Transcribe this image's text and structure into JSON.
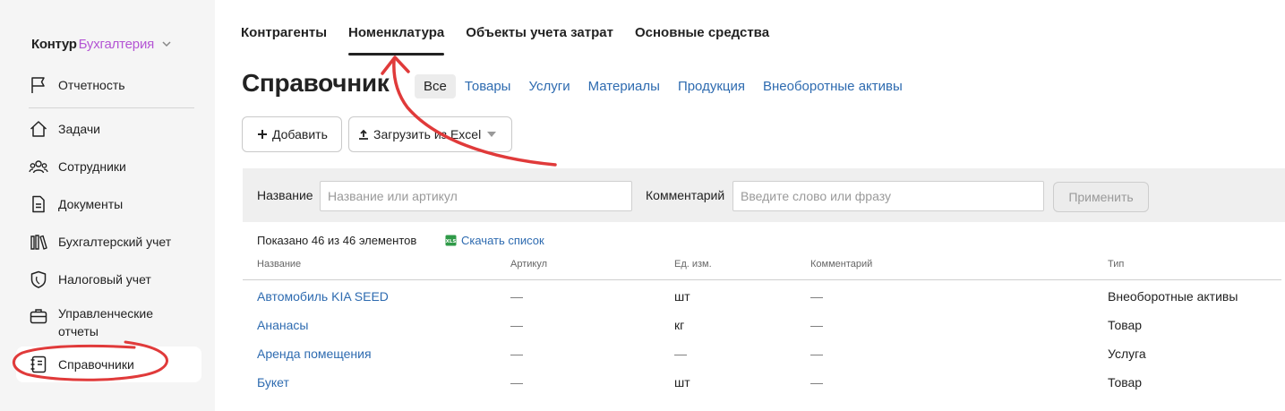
{
  "sidebar": {
    "brand": {
      "name": "Контур",
      "product": "Бухгалтерия"
    },
    "items": [
      {
        "id": "reporting",
        "label": "Отчетность",
        "icon": "flag-icon"
      },
      {
        "id": "tasks",
        "label": "Задачи",
        "icon": "house-icon"
      },
      {
        "id": "employees",
        "label": "Сотрудники",
        "icon": "people-icon"
      },
      {
        "id": "documents",
        "label": "Документы",
        "icon": "document-icon"
      },
      {
        "id": "accounting",
        "label": "Бухгалтерский учет",
        "icon": "books-icon"
      },
      {
        "id": "tax",
        "label": "Налоговый учет",
        "icon": "shield-icon"
      },
      {
        "id": "management",
        "label": "Управленческие отчеты",
        "icon": "briefcase-icon"
      },
      {
        "id": "directories",
        "label": "Справочники",
        "icon": "notebook-icon",
        "active": true
      }
    ]
  },
  "top_tabs": [
    {
      "label": "Контрагенты",
      "active": false
    },
    {
      "label": "Номенклатура",
      "active": true
    },
    {
      "label": "Объекты учета затрат",
      "active": false
    },
    {
      "label": "Основные средства",
      "active": false
    }
  ],
  "page_title": "Справочник",
  "filter_tabs": [
    {
      "label": "Все",
      "active": true
    },
    {
      "label": "Товары"
    },
    {
      "label": "Услуги"
    },
    {
      "label": "Материалы"
    },
    {
      "label": "Продукция"
    },
    {
      "label": "Внеоборотные активы"
    }
  ],
  "toolbar": {
    "add_label": "Добавить",
    "upload_label": "Загрузить из Excel"
  },
  "filters": {
    "name_label": "Название",
    "name_placeholder": "Название или артикул",
    "comment_label": "Комментарий",
    "comment_placeholder": "Введите слово или фразу",
    "apply_label": "Применить"
  },
  "summary": {
    "shown": "Показано 46 из 46 элементов",
    "download_label": "Скачать список",
    "download_icon_text": "XLS"
  },
  "table": {
    "columns": [
      "Название",
      "Артикул",
      "Ед. изм.",
      "Комментарий",
      "Тип"
    ],
    "rows": [
      {
        "name": "Автомобиль KIA SEED",
        "article": "—",
        "unit": "шт",
        "comment": "—",
        "type": "Внеоборотные активы"
      },
      {
        "name": "Ананасы",
        "article": "—",
        "unit": "кг",
        "comment": "—",
        "type": "Товар"
      },
      {
        "name": "Аренда помещения",
        "article": "—",
        "unit": "—",
        "comment": "—",
        "type": "Услуга"
      },
      {
        "name": "Букет",
        "article": "—",
        "unit": "шт",
        "comment": "—",
        "type": "Товар"
      }
    ]
  },
  "colors": {
    "link": "#2e6bb0",
    "brand_product": "#b455d4",
    "annotation": "#e03a3a",
    "sidebar_bg": "#f5f5f5"
  }
}
